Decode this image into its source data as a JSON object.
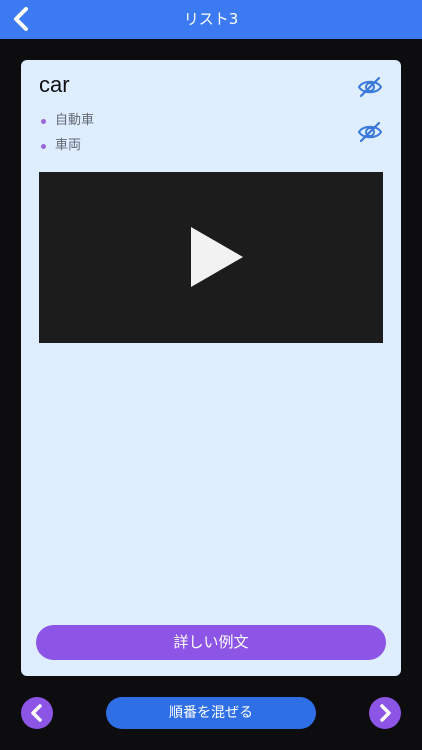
{
  "header": {
    "title": "リスト3",
    "back_icon": "chevron-left-icon",
    "background_color": "#3b7af0"
  },
  "card": {
    "word": "car",
    "meanings": [
      "自動車",
      "車両"
    ],
    "word_visibility_icon": "eye-off-icon",
    "meanings_visibility_icon": "eye-off-icon",
    "video_icon": "play-icon",
    "examples_button_label": "詳しい例文",
    "background_color": "#deeeff"
  },
  "footer": {
    "prev_icon": "chevron-left-icon",
    "next_icon": "chevron-right-icon",
    "shuffle_label": "順番を混ぜる",
    "accent_color": "#8c55e6",
    "shuffle_color": "#2f6fe6"
  }
}
